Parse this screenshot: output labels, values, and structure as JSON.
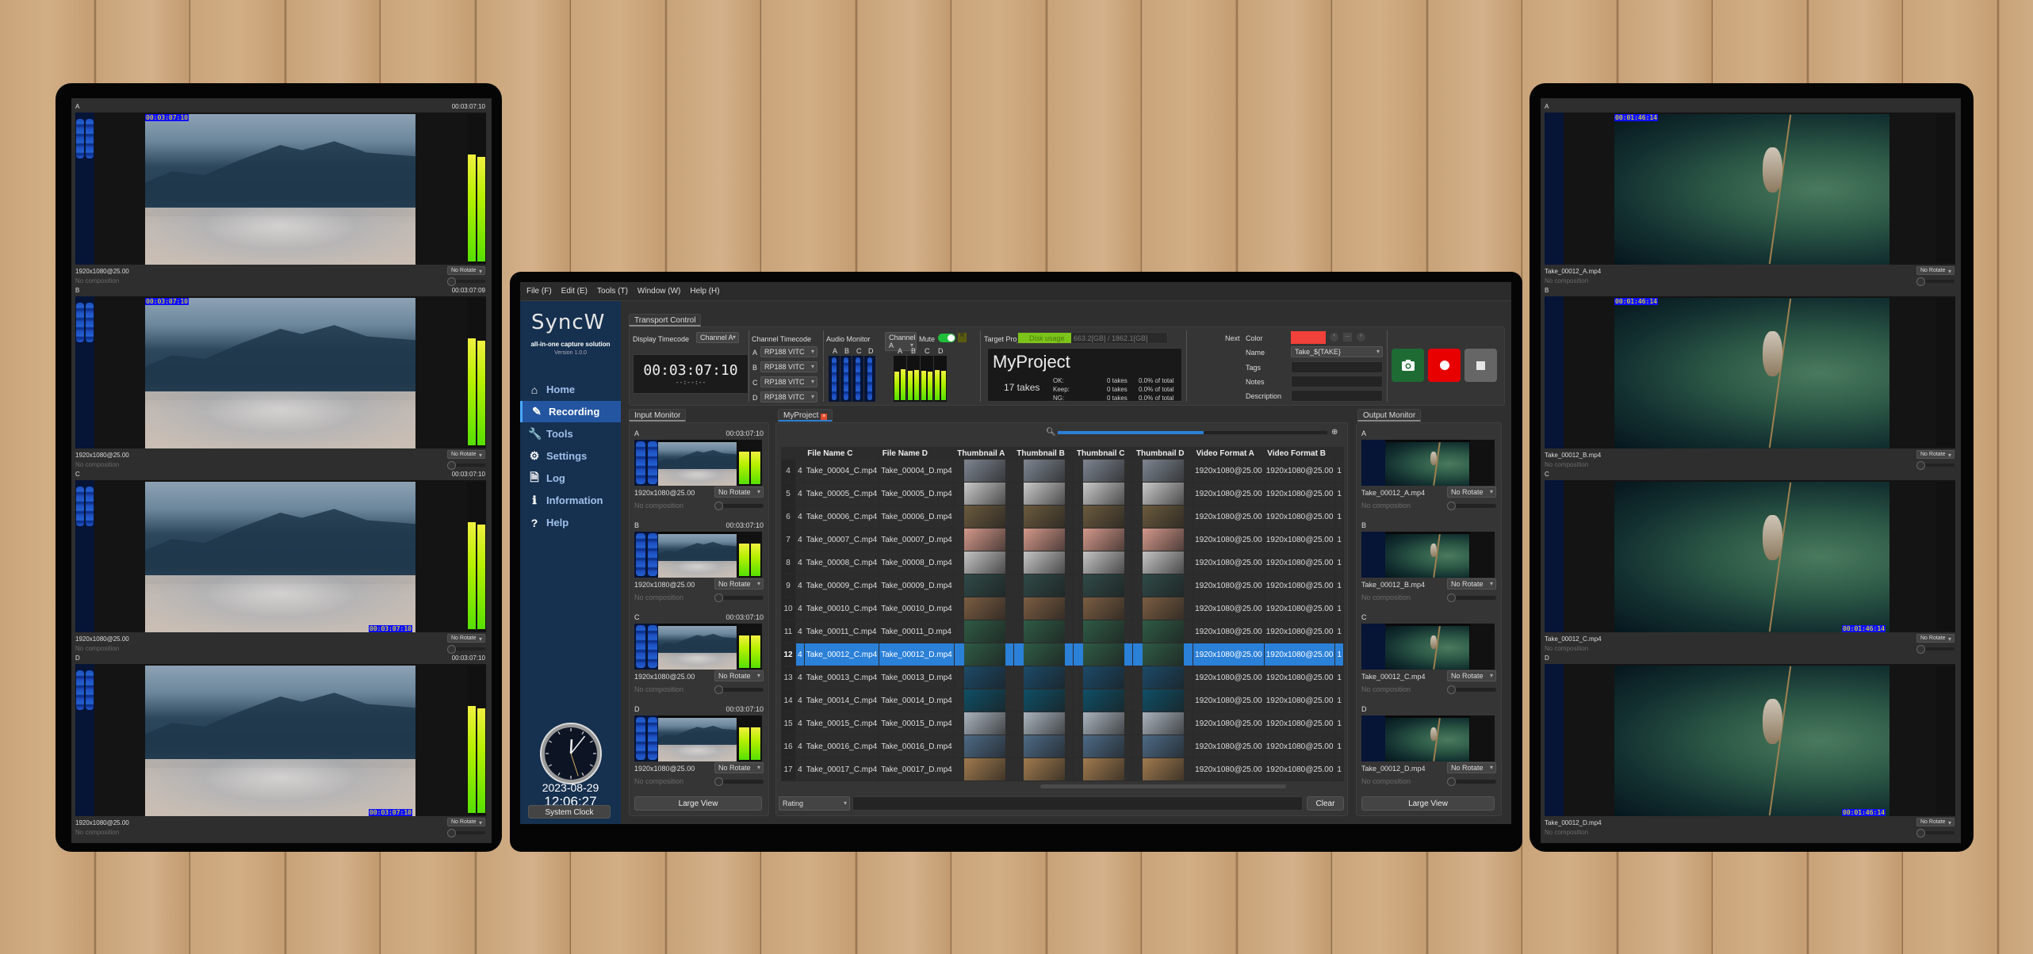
{
  "menu": [
    "File (F)",
    "Edit (E)",
    "Tools (T)",
    "Window (W)",
    "Help (H)"
  ],
  "brand": {
    "logo": "SyncW",
    "tagline": "all-in-one capture solution",
    "version": "Version 1.0.0",
    "accent": "#f29a2e"
  },
  "sidebar": {
    "items": [
      {
        "label": "Home",
        "icon": "home-icon",
        "glyph": "⌂",
        "active": false
      },
      {
        "label": "Recording",
        "icon": "pencil-icon",
        "glyph": "✎",
        "active": true
      },
      {
        "label": "Tools",
        "icon": "wrench-icon",
        "glyph": "🔧",
        "active": false
      },
      {
        "label": "Settings",
        "icon": "gear-icon",
        "glyph": "⚙",
        "active": false
      },
      {
        "label": "Log",
        "icon": "document-icon",
        "glyph": "🗎",
        "active": false
      },
      {
        "label": "Information",
        "icon": "info-icon",
        "glyph": "ℹ",
        "active": false
      },
      {
        "label": "Help",
        "icon": "help-icon",
        "glyph": "?",
        "active": false
      }
    ]
  },
  "clock": {
    "date": "2023-08-29",
    "time": "12:06:27",
    "button": "System Clock"
  },
  "transport": {
    "tab": "Transport Control",
    "display_timecode": {
      "label": "Display Timecode",
      "channel": "Channel A",
      "timecode": "00:03:07:10",
      "sub": "--:--:--"
    },
    "channel_timecode": {
      "label": "Channel Timecode",
      "rows": [
        {
          "ch": "A",
          "source": "RP188 VITC"
        },
        {
          "ch": "B",
          "source": "RP188 VITC"
        },
        {
          "ch": "C",
          "source": "RP188 VITC"
        },
        {
          "ch": "D",
          "source": "RP188 VITC"
        }
      ]
    },
    "audio_monitor": {
      "label": "Audio Monitor",
      "channel": "Channel A",
      "mute_label": "Mute",
      "mute_on": true,
      "r_label": "R",
      "wave_channels": [
        "A",
        "B",
        "C",
        "D"
      ],
      "meter_channels": [
        "A",
        "B",
        "C",
        "D"
      ],
      "levels": [
        0.62,
        0.68,
        0.64,
        0.66,
        0.64,
        0.62,
        0.66,
        0.64
      ]
    },
    "target_project": {
      "label": "Target Project",
      "disk_label": "Disk usage",
      "disk_value": "663.2[GB] / 1862.1[GB]",
      "disk_fraction": 0.356,
      "name": "MyProject",
      "takes": "17 takes",
      "stats": [
        {
          "label": "OK:",
          "takes": "0 takes",
          "pct": "0.0% of total"
        },
        {
          "label": "Keep:",
          "takes": "0 takes",
          "pct": "0.0% of total"
        },
        {
          "label": "NG:",
          "takes": "0 takes",
          "pct": "0.0% of total"
        }
      ]
    },
    "next": {
      "label": "Next",
      "color_label": "Color",
      "color": "#f2403a",
      "name_label": "Name",
      "name_value": "Take_${TAKE}",
      "tags_label": "Tags",
      "notes_label": "Notes",
      "description_label": "Description",
      "nav": [
        "‹",
        "...",
        "›"
      ]
    },
    "buttons": {
      "snapshot_color": "#1e6b34",
      "record_color": "#e80000",
      "stop_color": "#666666"
    }
  },
  "input_monitor": {
    "tab": "Input Monitor",
    "large_view": "Large View",
    "panes": [
      {
        "label": "A",
        "timecode": "00:03:07:10",
        "info": "1920x1080@25.00",
        "rotate": "No Rotate",
        "composition": "No composition"
      },
      {
        "label": "B",
        "timecode": "00:03:07:10",
        "info": "1920x1080@25.00",
        "rotate": "No Rotate",
        "composition": "No composition"
      },
      {
        "label": "C",
        "timecode": "00:03:07:10",
        "info": "1920x1080@25.00",
        "rotate": "No Rotate",
        "composition": "No composition"
      },
      {
        "label": "D",
        "timecode": "00:03:07:10",
        "info": "1920x1080@25.00",
        "rotate": "No Rotate",
        "composition": "No composition"
      }
    ]
  },
  "output_monitor": {
    "tab": "Output Monitor",
    "large_view": "Large View",
    "panes": [
      {
        "label": "A",
        "timecode": "",
        "info": "Take_00012_A.mp4",
        "rotate": "No Rotate",
        "composition": "No composition"
      },
      {
        "label": "B",
        "timecode": "",
        "info": "Take_00012_B.mp4",
        "rotate": "No Rotate",
        "composition": "No composition"
      },
      {
        "label": "C",
        "timecode": "",
        "info": "Take_00012_C.mp4",
        "rotate": "No Rotate",
        "composition": "No composition"
      },
      {
        "label": "D",
        "timecode": "",
        "info": "Take_00012_D.mp4",
        "rotate": "No Rotate",
        "composition": "No composition"
      }
    ]
  },
  "project": {
    "tab": "MyProject",
    "zoom_fraction": 0.54,
    "columns": [
      "",
      "",
      "File Name C",
      "File Name D",
      "Thumbnail A",
      "Thumbnail B",
      "Thumbnail C",
      "Thumbnail D",
      "Video Format A",
      "Video Format B",
      ""
    ],
    "selected_row": "12",
    "rows": [
      {
        "n": "4",
        "ch": "4",
        "c": "Take_00004_C.mp4",
        "d": "Take_00004_D.mp4",
        "fa": "1920x1080@25.00",
        "fb": "1920x1080@25.00",
        "x": "1",
        "thumb": "#7d8590"
      },
      {
        "n": "5",
        "ch": "4",
        "c": "Take_00005_C.mp4",
        "d": "Take_00005_D.mp4",
        "fa": "1920x1080@25.00",
        "fb": "1920x1080@25.00",
        "x": "1",
        "thumb": "#c9c9c9"
      },
      {
        "n": "6",
        "ch": "4",
        "c": "Take_00006_C.mp4",
        "d": "Take_00006_D.mp4",
        "fa": "1920x1080@25.00",
        "fb": "1920x1080@25.00",
        "x": "1",
        "thumb": "#6b5a3e"
      },
      {
        "n": "7",
        "ch": "4",
        "c": "Take_00007_C.mp4",
        "d": "Take_00007_D.mp4",
        "fa": "1920x1080@25.00",
        "fb": "1920x1080@25.00",
        "x": "1",
        "thumb": "#d4988a"
      },
      {
        "n": "8",
        "ch": "4",
        "c": "Take_00008_C.mp4",
        "d": "Take_00008_D.mp4",
        "fa": "1920x1080@25.00",
        "fb": "1920x1080@25.00",
        "x": "1",
        "thumb": "#c4c4c4"
      },
      {
        "n": "9",
        "ch": "4",
        "c": "Take_00009_C.mp4",
        "d": "Take_00009_D.mp4",
        "fa": "1920x1080@25.00",
        "fb": "1920x1080@25.00",
        "x": "1",
        "thumb": "#2f4a48"
      },
      {
        "n": "10",
        "ch": "4",
        "c": "Take_00010_C.mp4",
        "d": "Take_00010_D.mp4",
        "fa": "1920x1080@25.00",
        "fb": "1920x1080@25.00",
        "x": "1",
        "thumb": "#7a5d42"
      },
      {
        "n": "11",
        "ch": "4",
        "c": "Take_00011_C.mp4",
        "d": "Take_00011_D.mp4",
        "fa": "1920x1080@25.00",
        "fb": "1920x1080@25.00",
        "x": "1",
        "thumb": "#2f5b45"
      },
      {
        "n": "12",
        "ch": "4",
        "c": "Take_00012_C.mp4",
        "d": "Take_00012_D.mp4",
        "fa": "1920x1080@25.00",
        "fb": "1920x1080@25.00",
        "x": "1",
        "thumb": "#2f5b45"
      },
      {
        "n": "13",
        "ch": "4",
        "c": "Take_00013_C.mp4",
        "d": "Take_00013_D.mp4",
        "fa": "1920x1080@25.00",
        "fb": "1920x1080@25.00",
        "x": "1",
        "thumb": "#1c4a68"
      },
      {
        "n": "14",
        "ch": "4",
        "c": "Take_00014_C.mp4",
        "d": "Take_00014_D.mp4",
        "fa": "1920x1080@25.00",
        "fb": "1920x1080@25.00",
        "x": "1",
        "thumb": "#0f4f66"
      },
      {
        "n": "15",
        "ch": "4",
        "c": "Take_00015_C.mp4",
        "d": "Take_00015_D.mp4",
        "fa": "1920x1080@25.00",
        "fb": "1920x1080@25.00",
        "x": "1",
        "thumb": "#a9b3bd"
      },
      {
        "n": "16",
        "ch": "4",
        "c": "Take_00016_C.mp4",
        "d": "Take_00016_D.mp4",
        "fa": "1920x1080@25.00",
        "fb": "1920x1080@25.00",
        "x": "1",
        "thumb": "#4d6a85"
      },
      {
        "n": "17",
        "ch": "4",
        "c": "Take_00017_C.mp4",
        "d": "Take_00017_D.mp4",
        "fa": "1920x1080@25.00",
        "fb": "1920x1080@25.00",
        "x": "1",
        "thumb": "#a07a4e"
      }
    ],
    "filter": {
      "field": "Rating",
      "value": "",
      "clear": "Clear"
    }
  },
  "left_display": {
    "panes": [
      {
        "label": "A",
        "timecode": "00:03:07:10",
        "burnin": "00:03:07:10",
        "burnin_pos": "top",
        "info": "1920x1080@25.00",
        "rotate": "No Rotate",
        "composition": "No composition"
      },
      {
        "label": "B",
        "timecode": "00:03:07:09",
        "burnin": "00:03:07:10",
        "burnin_pos": "top",
        "info": "1920x1080@25.00",
        "rotate": "No Rotate",
        "composition": "No composition"
      },
      {
        "label": "C",
        "timecode": "00:03:07:10",
        "burnin": "00:03:07:10",
        "burnin_pos": "bottom",
        "info": "1920x1080@25.00",
        "rotate": "No Rotate",
        "composition": "No composition"
      },
      {
        "label": "D",
        "timecode": "00:03:07:10",
        "burnin": "00:03:07:10",
        "burnin_pos": "bottom",
        "info": "1920x1080@25.00",
        "rotate": "No Rotate",
        "composition": "No composition"
      }
    ]
  },
  "right_display": {
    "panes": [
      {
        "label": "A",
        "timecode": "",
        "burnin": "00:01:46:14",
        "burnin_pos": "top",
        "info": "Take_00012_A.mp4",
        "rotate": "No Rotate",
        "composition": "No composition"
      },
      {
        "label": "B",
        "timecode": "",
        "burnin": "00:01:46:14",
        "burnin_pos": "top",
        "info": "Take_00012_B.mp4",
        "rotate": "No Rotate",
        "composition": "No composition"
      },
      {
        "label": "C",
        "timecode": "",
        "burnin": "00:01:46:14",
        "burnin_pos": "bottom",
        "info": "Take_00012_C.mp4",
        "rotate": "No Rotate",
        "composition": "No composition"
      },
      {
        "label": "D",
        "timecode": "",
        "burnin": "00:01:46:14",
        "burnin_pos": "bottom",
        "info": "Take_00012_D.mp4",
        "rotate": "No Rotate",
        "composition": "No composition"
      }
    ]
  }
}
